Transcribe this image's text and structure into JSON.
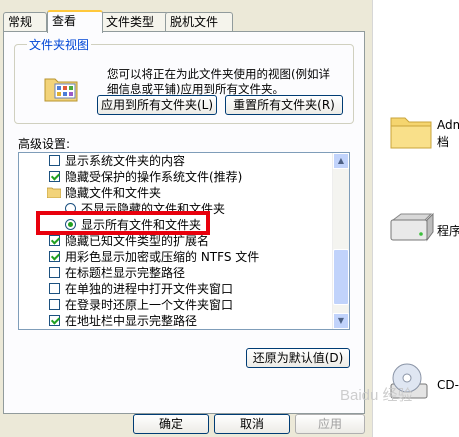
{
  "tabs": [
    {
      "label": "常规"
    },
    {
      "label": "查看"
    },
    {
      "label": "文件类型"
    },
    {
      "label": "脱机文件"
    }
  ],
  "active_tab": "查看",
  "folder_views": {
    "title": "文件夹视图",
    "description": "您可以将正在为此文件夹使用的视图(例如详细信息或平铺)应用到所有文件夹。",
    "apply_button": "应用到所有文件夹(L)",
    "reset_button": "重置所有文件夹(R)"
  },
  "advanced": {
    "label": "高级设置:",
    "items": [
      {
        "type": "checkbox",
        "label": "显示系统文件夹的内容",
        "checked": false
      },
      {
        "type": "checkbox",
        "label": "隐藏受保护的操作系统文件(推荐)",
        "checked": true
      },
      {
        "type": "folder",
        "label": "隐藏文件和文件夹"
      },
      {
        "type": "radio",
        "label": "不显示隐藏的文件和文件夹",
        "selected": false
      },
      {
        "type": "radio",
        "label": "显示所有文件和文件夹",
        "selected": true
      },
      {
        "type": "checkbox",
        "label": "隐藏已知文件类型的扩展名",
        "checked": true
      },
      {
        "type": "checkbox",
        "label": "用彩色显示加密或压缩的 NTFS 文件",
        "checked": true
      },
      {
        "type": "checkbox",
        "label": "在标题栏显示完整路径",
        "checked": false
      },
      {
        "type": "checkbox",
        "label": "在单独的进程中打开文件夹窗口",
        "checked": false
      },
      {
        "type": "checkbox",
        "label": "在登录时还原上一个文件夹窗口",
        "checked": false
      },
      {
        "type": "checkbox",
        "label": "在地址栏中显示完整路径",
        "checked": true
      }
    ],
    "restore_defaults_button": "还原为默认值(D)"
  },
  "footer": {
    "ok": "确定",
    "cancel": "取消",
    "apply": "应用"
  },
  "right_pane": {
    "items": [
      {
        "label": "Admi",
        "sub": "档"
      },
      {
        "label": "程序"
      },
      {
        "label": "CD-E"
      }
    ]
  },
  "watermark": "Baidu 经验",
  "colors": {
    "dialog_bg": "#ece9d8",
    "tab_accent": "#ffc83c",
    "group_title": "#0046d5",
    "checkmark": "#21a121",
    "highlight": "#e8000d"
  }
}
